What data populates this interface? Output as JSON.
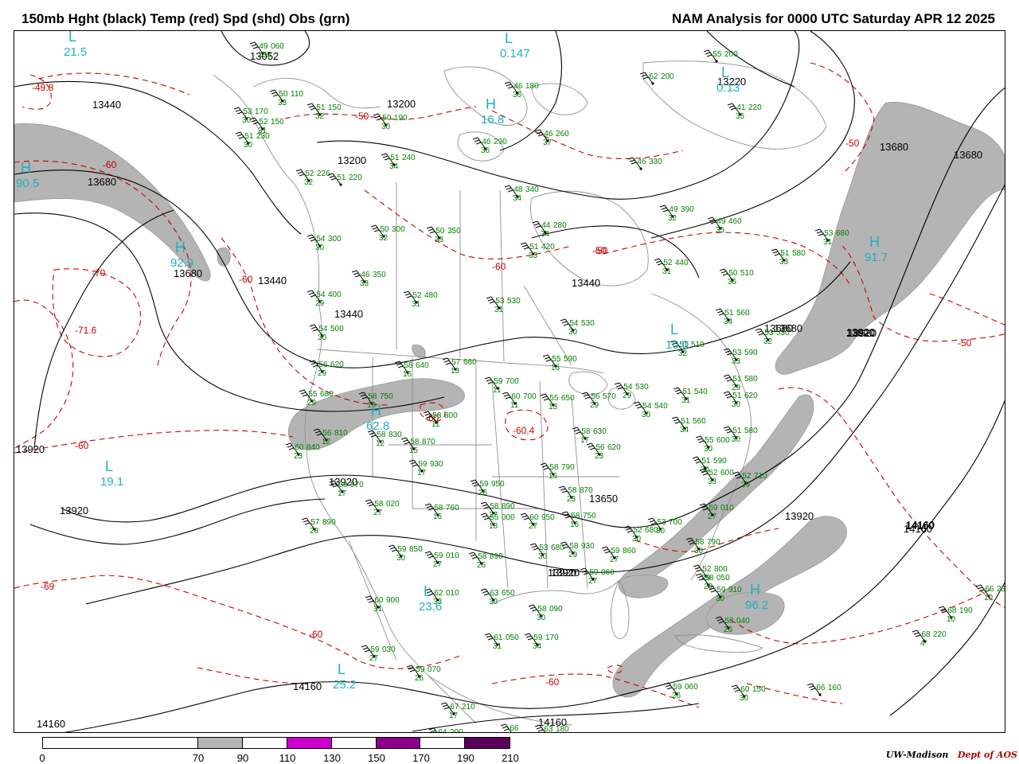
{
  "header": {
    "left_title": "150mb Hght (black) Temp (red) Spd (shd) Obs (grn)",
    "right_title": "NAM Analysis for 0000 UTC Saturday  APR 12 2025"
  },
  "colors": {
    "height_contour": "#000000",
    "temp_contour": "#cc0000",
    "speed_shade": "#b4b4b4",
    "obs": "#008000",
    "center_label": "#20b0c0",
    "geography": "#909090"
  },
  "legend": {
    "ticks": [
      "0",
      "70",
      "90",
      "110",
      "130",
      "150",
      "170",
      "190",
      "210"
    ],
    "segments": [
      {
        "from": 0,
        "to": 70,
        "color": "#ffffff"
      },
      {
        "from": 70,
        "to": 90,
        "color": "#b4b4b4"
      },
      {
        "from": 90,
        "to": 110,
        "color": "#ffffff"
      },
      {
        "from": 110,
        "to": 130,
        "color": "#cc00cc"
      },
      {
        "from": 130,
        "to": 150,
        "color": "#ffffff"
      },
      {
        "from": 150,
        "to": 170,
        "color": "#8b008b"
      },
      {
        "from": 170,
        "to": 190,
        "color": "#ffffff"
      },
      {
        "from": 190,
        "to": 210,
        "color": "#5a005a"
      }
    ]
  },
  "credit": {
    "org": "UW-Madison",
    "dept": "Dept of AOS"
  },
  "height_labels": [
    "13052",
    "13440",
    "13200",
    "13200",
    "13680",
    "13680",
    "13440",
    "13440",
    "13680",
    "13920",
    "13920",
    "13920",
    "13680",
    "13920",
    "13440",
    "13680",
    "13920",
    "13650",
    "13920",
    "14160",
    "14160",
    "14160",
    "13920",
    "14160",
    "14160",
    "13920",
    "14160",
    "13680",
    "13920",
    "13220"
  ],
  "temp_labels": [
    "-49.8",
    "-60",
    "-70",
    "-71.6",
    "-60",
    "-60",
    "-69",
    "-60",
    "-60",
    "-60.4",
    "-60",
    "-50",
    "-50",
    "-50",
    "-50",
    "-60",
    "-50"
  ],
  "centers": [
    {
      "letter": "L",
      "value": "21.5"
    },
    {
      "letter": "H",
      "value": "90.5"
    },
    {
      "letter": "H",
      "value": "92.9"
    },
    {
      "letter": "L",
      "value": "19.1"
    },
    {
      "letter": "H",
      "value": "16.8"
    },
    {
      "letter": "L",
      "value": "0.147"
    },
    {
      "letter": "L",
      "value": "0.13"
    },
    {
      "letter": "H",
      "value": "91.7"
    },
    {
      "letter": "L",
      "value": "10.0"
    },
    {
      "letter": "H",
      "value": "62.8"
    },
    {
      "letter": "L",
      "value": "23.6"
    },
    {
      "letter": "L",
      "value": "25.2"
    },
    {
      "letter": "H",
      "value": "96.2"
    }
  ],
  "stations": [
    {
      "t": "-49",
      "h": "060",
      "d": "135"
    },
    {
      "t": "-50",
      "h": "110",
      "d": "33"
    },
    {
      "t": "-51",
      "h": "150",
      "d": "32"
    },
    {
      "t": "-53",
      "h": "170",
      "d": "30"
    },
    {
      "t": "-52",
      "h": "150",
      "d": "31"
    },
    {
      "t": "-51",
      "h": "230",
      "d": "30"
    },
    {
      "t": "-50",
      "h": "190",
      "d": "30"
    },
    {
      "t": "-46",
      "h": "180",
      "d": "36"
    },
    {
      "t": "-46",
      "h": "290",
      "d": "36"
    },
    {
      "t": "-46",
      "h": "260",
      "d": "37"
    },
    {
      "t": "-52",
      "h": "226",
      "d": "32"
    },
    {
      "t": "-51",
      "h": "220",
      "d": ""
    },
    {
      "t": "-51",
      "h": "240",
      "d": "34"
    },
    {
      "t": "-46",
      "h": "330",
      "d": ""
    },
    {
      "t": "-48",
      "h": "340",
      "d": "34"
    },
    {
      "t": "-49",
      "h": "390",
      "d": "32"
    },
    {
      "t": "-49",
      "h": "460",
      "d": "35"
    },
    {
      "t": "-50",
      "h": "300",
      "d": "32"
    },
    {
      "t": "-50",
      "h": "350",
      "d": "33"
    },
    {
      "t": "-54",
      "h": "300",
      "d": "30"
    },
    {
      "t": "-51",
      "h": "420",
      "d": "33"
    },
    {
      "t": "-52",
      "h": "440",
      "d": "31"
    },
    {
      "t": "-50",
      "h": "510",
      "d": "36"
    },
    {
      "t": "-51",
      "h": "580",
      "d": "33"
    },
    {
      "t": "-53",
      "h": "680",
      "d": "31"
    },
    {
      "t": "-46",
      "h": "350",
      "d": "33"
    },
    {
      "t": "-52",
      "h": "480",
      "d": "31"
    },
    {
      "t": "-54",
      "h": "400",
      "d": "29"
    },
    {
      "t": "-53",
      "h": "530",
      "d": "31"
    },
    {
      "t": "-54",
      "h": "530",
      "d": "30"
    },
    {
      "t": "-51",
      "h": "560",
      "d": "34"
    },
    {
      "t": "-53",
      "h": "530",
      "d": "32"
    },
    {
      "t": "-54",
      "h": "500",
      "d": "30"
    },
    {
      "t": "-56",
      "h": "620",
      "d": "29"
    },
    {
      "t": "-58",
      "h": "640",
      "d": "16"
    },
    {
      "t": "-57",
      "h": "660",
      "d": "13"
    },
    {
      "t": "-55",
      "h": "590",
      "d": "16"
    },
    {
      "t": "-51",
      "h": "510",
      "d": "32"
    },
    {
      "t": "-53",
      "h": "590",
      "d": "33"
    },
    {
      "t": "-55",
      "h": "680",
      "d": "29"
    },
    {
      "t": "-58",
      "h": "750",
      "d": "10"
    },
    {
      "t": "-59",
      "h": "700",
      "d": "11"
    },
    {
      "t": "-60",
      "h": "700",
      "d": "11"
    },
    {
      "t": "-55",
      "h": "650",
      "d": "13"
    },
    {
      "t": "-56",
      "h": "570",
      "d": "29"
    },
    {
      "t": "-54",
      "h": "530",
      "d": "29"
    },
    {
      "t": "-54",
      "h": "540",
      "d": "30"
    },
    {
      "t": "-51",
      "h": "540",
      "d": "31"
    },
    {
      "t": "-51",
      "h": "580",
      "d": "29"
    },
    {
      "t": "-51",
      "h": "620",
      "d": "30"
    },
    {
      "t": "-58",
      "h": "800",
      "d": "11"
    },
    {
      "t": "-56",
      "h": "810",
      "d": "12"
    },
    {
      "t": "-58",
      "h": "830",
      "d": "12"
    },
    {
      "t": "-60",
      "h": "840",
      "d": "23"
    },
    {
      "t": "-58",
      "h": "870",
      "d": "15"
    },
    {
      "t": "-58",
      "h": "630",
      "d": "17"
    },
    {
      "t": "-56",
      "h": "620",
      "d": "23"
    },
    {
      "t": "-51",
      "h": "560",
      "d": "34"
    },
    {
      "t": "-55",
      "h": "600",
      "d": "30"
    },
    {
      "t": "-51",
      "h": "580",
      "d": "30"
    },
    {
      "t": "-59",
      "h": "930",
      "d": "17"
    },
    {
      "t": "-51",
      "h": "590",
      "d": "34"
    },
    {
      "t": "-52",
      "h": "600",
      "d": "33"
    },
    {
      "t": "-52",
      "h": "710",
      "d": "29"
    },
    {
      "t": "-58",
      "h": "790",
      "d": "16"
    },
    {
      "t": "-59",
      "h": "950",
      "d": "26"
    },
    {
      "t": "-59",
      "h": "970",
      "d": "17"
    },
    {
      "t": "-58",
      "h": "890",
      "d": "27"
    },
    {
      "t": "-58",
      "h": "870",
      "d": "23"
    },
    {
      "t": "-58",
      "h": "750",
      "d": "16"
    },
    {
      "t": "-58",
      "h": "760",
      "d": "16"
    },
    {
      "t": "-55",
      "h": "000",
      "d": "18"
    },
    {
      "t": "-60",
      "h": "950",
      "d": "27"
    },
    {
      "t": "-57",
      "h": "890",
      "d": "28"
    },
    {
      "t": "-58",
      "h": "020",
      "d": "27"
    },
    {
      "t": "-59",
      "h": "010",
      "d": "27"
    },
    {
      "t": "-53",
      "h": "700",
      "d": "30"
    },
    {
      "t": "-52",
      "h": "680",
      "d": "30"
    },
    {
      "t": "-53",
      "h": "680",
      "d": "30"
    },
    {
      "t": "-58",
      "h": "930",
      "d": "29"
    },
    {
      "t": "-59",
      "h": "860",
      "d": "27"
    },
    {
      "t": "-58",
      "h": "790",
      "d": "30"
    },
    {
      "t": "-52",
      "h": "800",
      "d": "29"
    },
    {
      "t": "-58",
      "h": "890",
      "d": "26"
    },
    {
      "t": "-59",
      "h": "850",
      "d": "30"
    },
    {
      "t": "-59",
      "h": "010",
      "d": "27"
    },
    {
      "t": "-59",
      "h": "060",
      "d": "27"
    },
    {
      "t": "-58",
      "h": "050",
      "d": "20"
    },
    {
      "t": "-59",
      "h": "910",
      "d": "30"
    },
    {
      "t": "-60",
      "h": "900",
      "d": "31"
    },
    {
      "t": "-62",
      "h": "010",
      "d": "33"
    },
    {
      "t": "-63",
      "h": "650",
      "d": "30"
    },
    {
      "t": "-58",
      "h": "090",
      "d": "30"
    },
    {
      "t": "-58",
      "h": "040",
      "d": "26"
    },
    {
      "t": "-59",
      "h": "030",
      "d": "27"
    },
    {
      "t": "-61",
      "h": "050",
      "d": "31"
    },
    {
      "t": "-59",
      "h": "170",
      "d": "34"
    },
    {
      "t": "-59",
      "h": "070",
      "d": "26"
    },
    {
      "t": "-59",
      "h": "060",
      "d": "26"
    },
    {
      "t": "-60",
      "h": "150",
      "d": "30"
    },
    {
      "t": "-66",
      "h": "160",
      "d": ""
    },
    {
      "t": "-68",
      "h": "190",
      "d": "10"
    },
    {
      "t": "-68",
      "h": "220",
      "d": "4"
    },
    {
      "t": "-66",
      "h": "230",
      "d": "10"
    },
    {
      "t": "-67",
      "h": "210",
      "d": "17"
    },
    {
      "t": "-66",
      "h": "",
      "d": "9"
    },
    {
      "t": "-63",
      "h": "180",
      "d": "27"
    },
    {
      "t": "-64",
      "h": "200",
      "d": ""
    },
    {
      "t": "-55",
      "h": "200",
      "d": ""
    },
    {
      "t": "-62",
      "h": "200",
      "d": ""
    },
    {
      "t": "-41",
      "h": "220",
      "d": "35"
    },
    {
      "t": "-44",
      "h": "280",
      "d": "34"
    },
    {
      "t": "-42",
      "h": "230",
      "d": "35"
    },
    {
      "t": "-46",
      "h": "",
      "d": ""
    }
  ]
}
